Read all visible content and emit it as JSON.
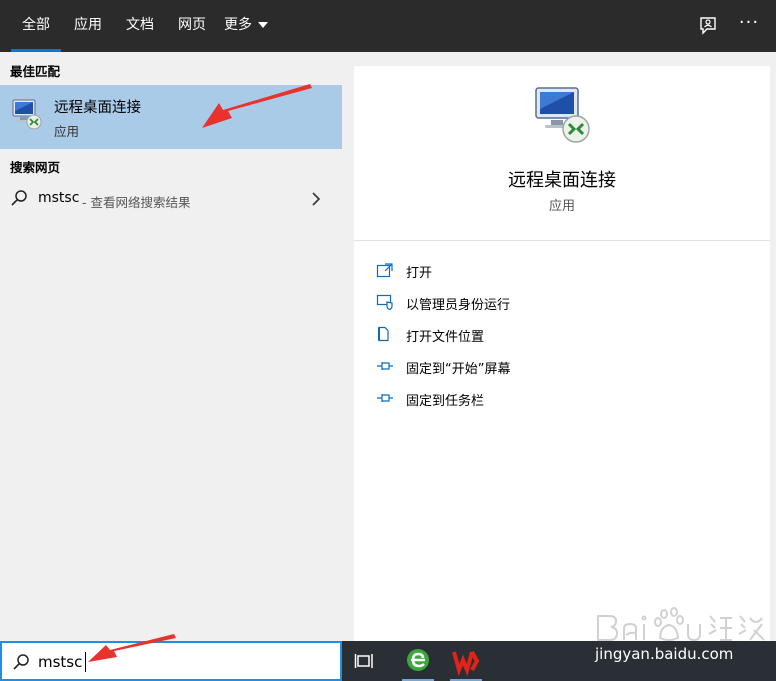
{
  "tabs": {
    "all": "全部",
    "apps": "应用",
    "documents": "文档",
    "web": "网页",
    "more": "更多"
  },
  "header": {
    "more_options": "···"
  },
  "results": {
    "best_match_label": "最佳匹配",
    "best_match": {
      "name": "远程桌面连接",
      "type": "应用"
    },
    "search_web_label": "搜索网页",
    "web_result": {
      "query": "mstsc",
      "hint": "- 查看网络搜索结果"
    }
  },
  "details": {
    "title": "远程桌面连接",
    "subtitle": "应用",
    "actions": {
      "open": "打开",
      "run_as_admin": "以管理员身份运行",
      "open_file_location": "打开文件位置",
      "pin_to_start": "固定到“开始”屏幕",
      "pin_to_taskbar": "固定到任务栏"
    }
  },
  "search": {
    "value": "mstsc"
  },
  "watermark": {
    "url": "jingyan.baidu.com"
  },
  "colors": {
    "accent": "#0078d7",
    "selection": "#a9cbe8",
    "annotation_arrow": "#e8322d",
    "topbar": "#2b2b2b",
    "taskbar": "#2a2f36"
  },
  "icons": {
    "feedback": "feedback-icon",
    "search": "search-icon",
    "remote_desktop": "remote-desktop-icon",
    "chevron": "chevron-right-icon",
    "task_view": "task-view-icon",
    "browser": "browser-icon",
    "wps": "wps-office-icon"
  }
}
